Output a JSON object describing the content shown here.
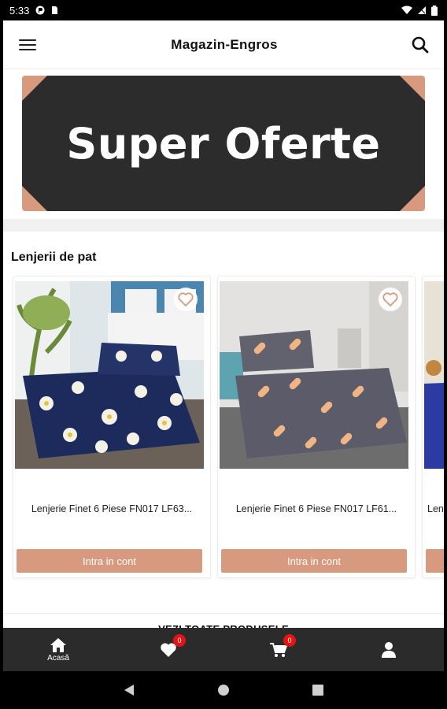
{
  "status_bar": {
    "time": "5:33"
  },
  "header": {
    "title": "Magazin-Engros"
  },
  "banner": {
    "text": "Super Oferte"
  },
  "section": {
    "title": "Lenjerii de pat"
  },
  "products": [
    {
      "name": "Lenjerie Finet 6 Piese FN017  LF63...",
      "cta": "Intra in cont"
    },
    {
      "name": "Lenjerie Finet 6 Piese FN017 LF61...",
      "cta": "Intra in cont"
    },
    {
      "name": "Len",
      "cta": ""
    }
  ],
  "see_all": "VEZI TOATE PRODUSELE",
  "bottom_nav": {
    "home_label": "Acasă",
    "favorites_count": "0",
    "cart_count": "0"
  },
  "colors": {
    "accent": "#d89a7f",
    "nav_bg": "#2b2b2b",
    "badge": "#e31414",
    "banner_dark": "#2c2c2c"
  }
}
